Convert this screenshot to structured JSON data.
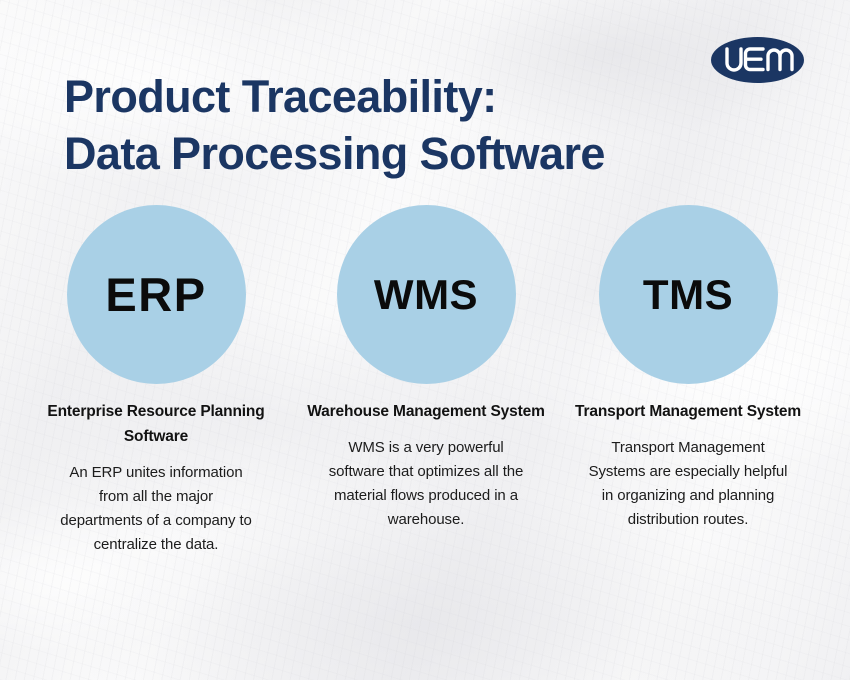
{
  "background_color": "#f4f4f5",
  "logo": {
    "name": "VEM",
    "text": "VEM",
    "shape": "ellipse",
    "fill_color": "#1b3663",
    "text_color": "#ffffff"
  },
  "title": {
    "line1": "Product Traceability:",
    "line2": "Data Processing Software",
    "color": "#1b3663"
  },
  "columns": [
    {
      "acronym": "ERP",
      "circle_color": "#a9d0e6",
      "acronym_color": "#0b0b0b",
      "heading": "Enterprise Resource Planning Software",
      "body": "An ERP unites information from all the major departments of a company to centralize the data."
    },
    {
      "acronym": "WMS",
      "circle_color": "#a9d0e6",
      "acronym_color": "#0b0b0b",
      "heading": "Warehouse Management System",
      "body": "WMS is a very powerful software that optimizes all the material flows produced in a warehouse."
    },
    {
      "acronym": "TMS",
      "circle_color": "#a9d0e6",
      "acronym_color": "#0b0b0b",
      "heading": "Transport Management System",
      "body": "Transport Management Systems are especially helpful in organizing and planning distribution routes."
    }
  ]
}
